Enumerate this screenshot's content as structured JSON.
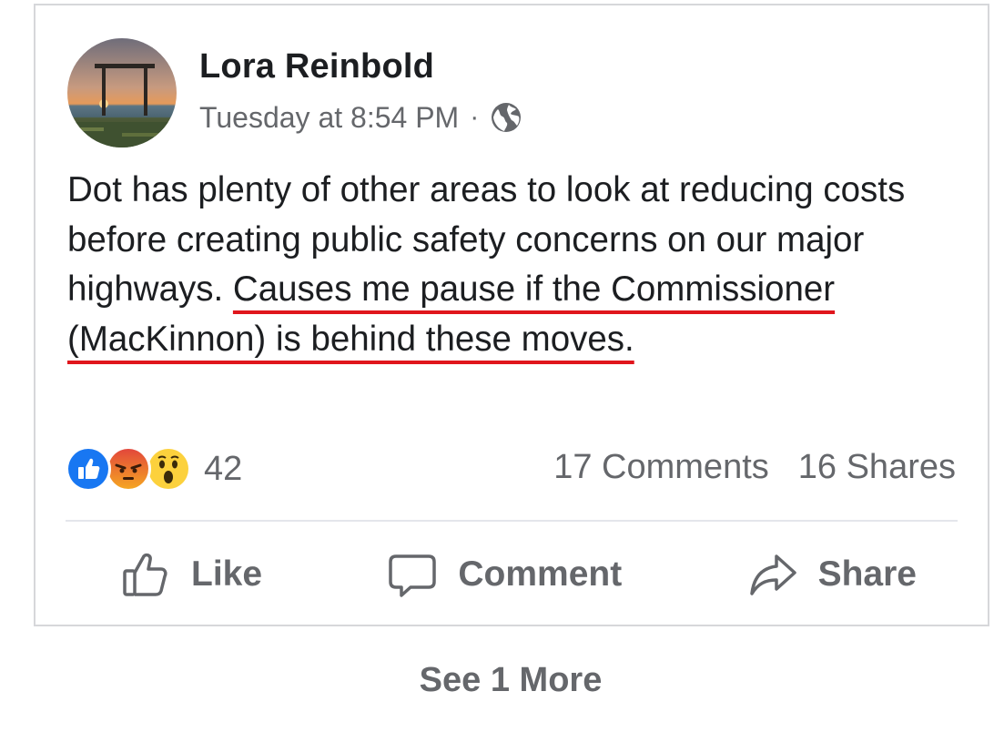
{
  "post": {
    "author": "Lora Reinbold",
    "timestamp": "Tuesday at 8:54 PM",
    "separator": "·",
    "privacy_icon": "globe-icon",
    "text_plain": "Dot has plenty of other areas to look at reducing costs before creating public safety concerns on our major highways. ",
    "text_highlighted": "Causes me pause if the Commissioner (MacKinnon) is behind these moves."
  },
  "engagement": {
    "reaction_icons": [
      "like-reaction-icon",
      "angry-reaction-icon",
      "wow-reaction-icon"
    ],
    "reaction_count": "42",
    "comments": "17 Comments",
    "shares": "16 Shares"
  },
  "actions": {
    "like_label": "Like",
    "comment_label": "Comment",
    "share_label": "Share"
  },
  "footer": {
    "see_more": "See 1 More"
  },
  "colors": {
    "underline": "#e0161d",
    "like_blue": "#1877f2",
    "secondary_text": "#65676b"
  }
}
